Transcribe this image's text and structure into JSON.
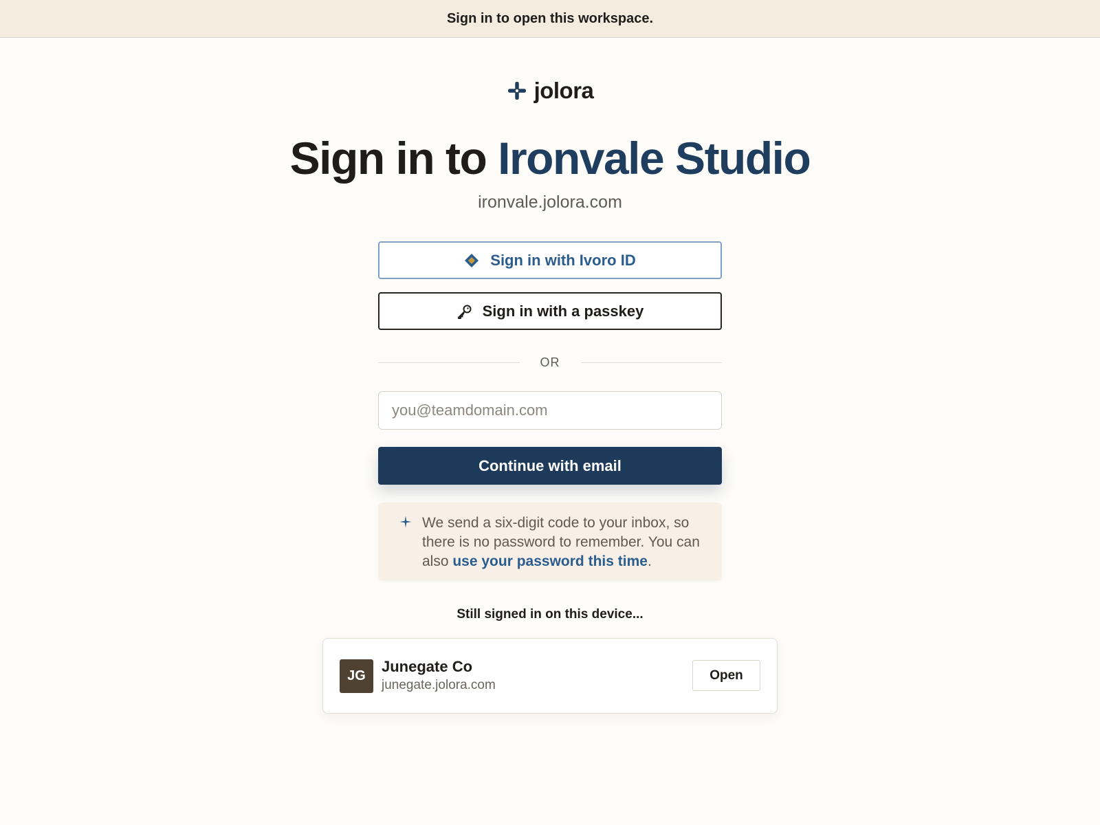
{
  "banner": {
    "text": "Sign in to open this workspace."
  },
  "logo": {
    "icon": "sparkle-cross-icon",
    "name": "jolora"
  },
  "title": {
    "prefix": "Sign in to ",
    "workspace": "Ironvale Studio"
  },
  "subdomain": "ironvale.jolora.com",
  "sso": {
    "ivoro_label": "Sign in with Ivoro ID",
    "ivoro_icon": "diamond-icon",
    "passkey_label": "Sign in with a passkey",
    "passkey_icon": "key-icon"
  },
  "divider": {
    "text": "OR"
  },
  "email": {
    "value": "",
    "placeholder": "you@teamdomain.com"
  },
  "continue_label": "Continue with email",
  "info": {
    "icon": "sparkle-icon",
    "text": "We send a six-digit code to your inbox, so there is no password to remember. You can also ",
    "link": "use your password this time",
    "suffix": "."
  },
  "still_signed_in": {
    "label": "Still signed in on this device...",
    "workspaces": [
      {
        "initials": "JG",
        "name": "Junegate Co",
        "domain": "junegate.jolora.com",
        "action": "Open"
      }
    ]
  },
  "colors": {
    "accent": "#1f3d5e",
    "primary_button": "#1e3a5a",
    "link": "#2a5c8e",
    "banner_bg": "#f3ecdf",
    "info_bg": "#f8f0e6",
    "avatar_bg": "#4f4232"
  }
}
